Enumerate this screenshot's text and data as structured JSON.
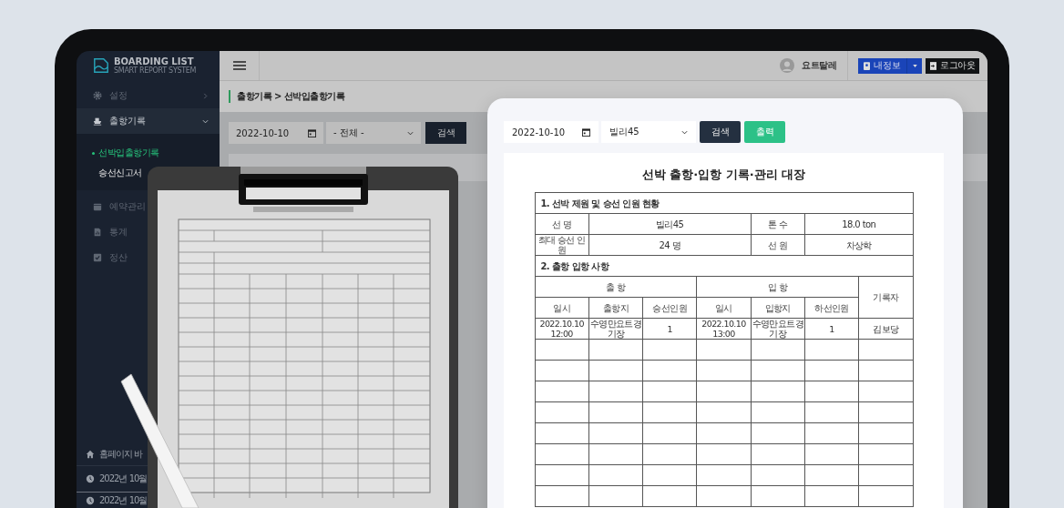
{
  "app": {
    "logo_title": "BOARDING LIST",
    "logo_subtitle": "SMART REPORT SYSTEM"
  },
  "sidebar": {
    "items": [
      {
        "kind": "group",
        "label": "설정",
        "expanded": false
      },
      {
        "kind": "group",
        "label": "출항기록",
        "expanded": true,
        "children": [
          {
            "label": "선박입출항기록",
            "selected": true
          },
          {
            "label": "승선신고서",
            "selected": false
          }
        ]
      },
      {
        "kind": "link",
        "label": "예약관리"
      },
      {
        "kind": "link",
        "label": "통계"
      },
      {
        "kind": "link",
        "label": "정산"
      }
    ],
    "footer": [
      {
        "kind": "home",
        "text": "홈페이지 바"
      },
      {
        "kind": "clock",
        "text": "2022년 10월"
      },
      {
        "kind": "clock",
        "text": "2022년 10월"
      }
    ]
  },
  "topbar": {
    "user_name": "요트탈레",
    "my_info": "내정보",
    "logout": "로그아웃"
  },
  "page": {
    "breadcrumb": "출항기록 > 선박입출항기록",
    "date": "2022-10-10",
    "filter": "- 전체 -",
    "search": "검색"
  },
  "print_preview": {
    "date": "2022-10-10",
    "vessel": "빌리45",
    "search": "검색",
    "print": "출력",
    "document": {
      "title": "선박 출항·입항 기록·관리 대장",
      "section1": "1. 선박 제원 및 승선 인원 현황",
      "info_rows": [
        [
          {
            "label": "선 명",
            "value": "빌리45"
          },
          {
            "label": "톤 수",
            "value": "18.0 ton"
          }
        ],
        [
          {
            "label": "최대 승선 인원",
            "value": "24 명"
          },
          {
            "label": "선 원",
            "value": "차상학"
          }
        ]
      ],
      "section2": "2. 출항 입항 사항",
      "departure": "출 항",
      "arrival": "입 항",
      "recorder": "기록자",
      "columns": [
        "일시",
        "출항지",
        "승선인원",
        "일시",
        "입항지",
        "하선인원"
      ],
      "rows": [
        [
          "2022.10.10\n12:00",
          "수영만요트경기장",
          "1",
          "2022.10.10\n13:00",
          "수영만요트경기장",
          "1",
          "김보당"
        ]
      ]
    }
  }
}
